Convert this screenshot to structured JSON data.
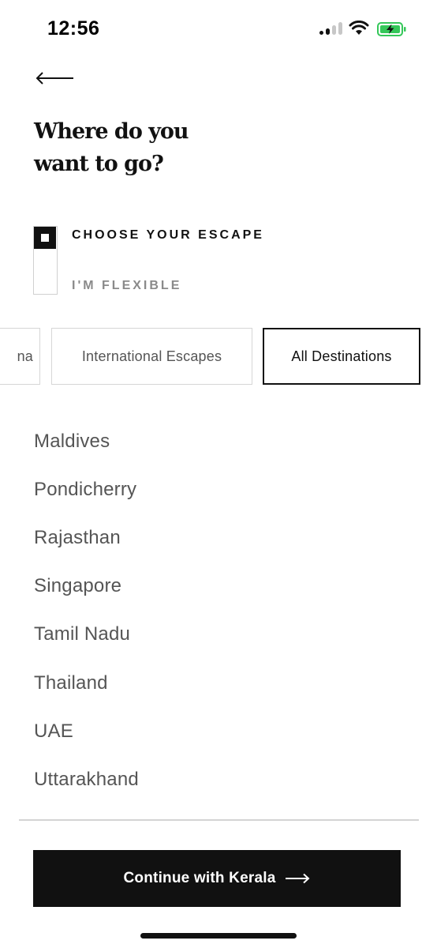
{
  "status_bar": {
    "time": "12:56",
    "battery_color": "#34c759"
  },
  "header": {
    "back_icon": "arrow-left-icon",
    "title_line1": "Where do you",
    "title_line2": "want to go?"
  },
  "mode_toggle": {
    "selected": "CHOOSE YOUR ESCAPE",
    "options": [
      "CHOOSE YOUR ESCAPE",
      "I'M FLEXIBLE"
    ]
  },
  "tabs": [
    {
      "label": "na",
      "active": false
    },
    {
      "label": "International Escapes",
      "active": false
    },
    {
      "label": "All Destinations",
      "active": true
    }
  ],
  "destinations": [
    "Maldives",
    "Pondicherry",
    "Rajasthan",
    "Singapore",
    "Tamil Nadu",
    "Thailand",
    "UAE",
    "Uttarakhand"
  ],
  "continue_button": {
    "label": "Continue with Kerala",
    "icon": "arrow-right-icon"
  }
}
